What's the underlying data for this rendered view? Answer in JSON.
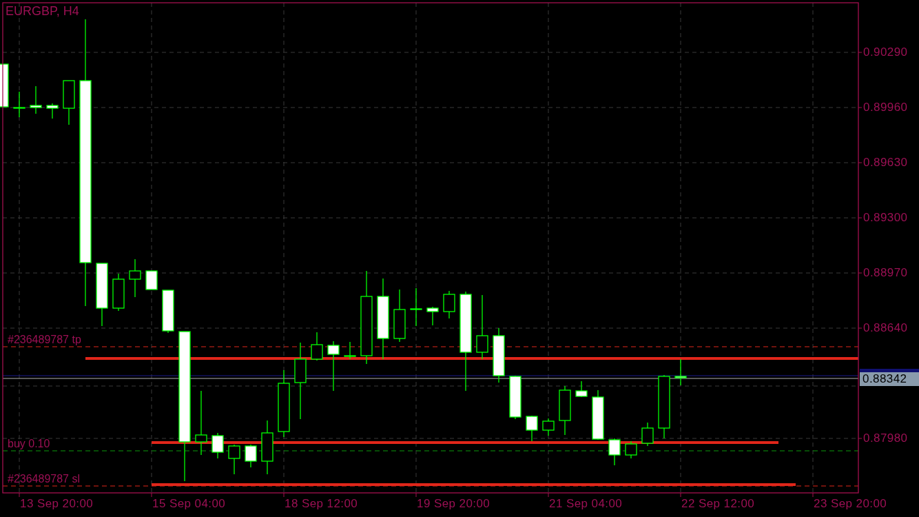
{
  "window": {
    "title": "EURGBP, H4"
  },
  "chart": {
    "price_axis_labels": [
      "0.90290",
      "0.89960",
      "0.89630",
      "0.89300",
      "0.88970",
      "0.88640",
      "0.87980"
    ],
    "time_axis_labels": [
      "13 Sep 20:00",
      "15 Sep 04:00",
      "18 Sep 12:00",
      "19 Sep 20:00",
      "21 Sep 04:00",
      "22 Sep 12:00",
      "23 Sep 20:00"
    ],
    "order_labels": [
      {
        "kind": "take_profit",
        "label": "#236489787 tp"
      },
      {
        "kind": "entry",
        "label": "buy 0.10"
      },
      {
        "kind": "stop_loss",
        "label": "#236489787 sl"
      }
    ],
    "price_tag": "0.88342"
  }
}
